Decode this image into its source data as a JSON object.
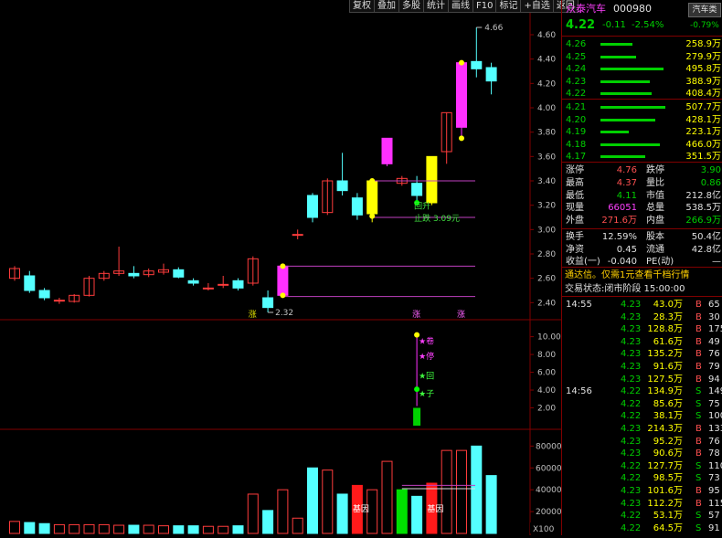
{
  "toolbar": [
    "复权",
    "叠加",
    "多股",
    "统计",
    "画线",
    "F10",
    "标记",
    "+自选",
    "返回"
  ],
  "header": {
    "name": "众泰汽车",
    "code": "000980",
    "sector_btn": "汽车类",
    "price": "4.22",
    "change": "-0.11",
    "pct": "-2.54%",
    "sector_pct": "-0.79%"
  },
  "asks": [
    {
      "price": "4.26",
      "vol": "258.9万",
      "bar": 0.42
    },
    {
      "price": "4.25",
      "vol": "279.9万",
      "bar": 0.46
    },
    {
      "price": "4.24",
      "vol": "495.8万",
      "bar": 0.82
    },
    {
      "price": "4.23",
      "vol": "388.9万",
      "bar": 0.64
    },
    {
      "price": "4.22",
      "vol": "408.4万",
      "bar": 0.67
    }
  ],
  "bids": [
    {
      "price": "4.21",
      "vol": "507.7万",
      "bar": 0.84
    },
    {
      "price": "4.20",
      "vol": "428.1万",
      "bar": 0.71
    },
    {
      "price": "4.19",
      "vol": "223.1万",
      "bar": 0.37
    },
    {
      "price": "4.18",
      "vol": "466.0万",
      "bar": 0.77
    },
    {
      "price": "4.17",
      "vol": "351.5万",
      "bar": 0.58
    }
  ],
  "stats": [
    {
      "l1": "涨停",
      "v1": "4.76",
      "c1": "up",
      "l2": "跌停",
      "v2": "3.90",
      "c2": "down"
    },
    {
      "l1": "最高",
      "v1": "4.37",
      "c1": "up",
      "l2": "量比",
      "v2": "0.86",
      "c2": "down"
    },
    {
      "l1": "最低",
      "v1": "4.11",
      "c1": "down",
      "l2": "市值",
      "v2": "212.8亿",
      "c2": "white"
    },
    {
      "l1": "现量",
      "v1": "66051",
      "c1": "magenta",
      "l2": "总量",
      "v2": "538.5万",
      "c2": "white"
    },
    {
      "l1": "外盘",
      "v1": "271.6万",
      "c1": "up",
      "l2": "内盘",
      "v2": "266.9万",
      "c2": "down"
    }
  ],
  "stats2": [
    {
      "l1": "换手",
      "v1": "12.59%",
      "l2": "股本",
      "v2": "50.4亿"
    },
    {
      "l1": "净资",
      "v1": "0.45",
      "l2": "流通",
      "v2": "42.8亿"
    },
    {
      "l1": "收益(一)",
      "v1": "-0.040",
      "l2": "PE(动)",
      "v2": "—"
    }
  ],
  "promo": "通达信。仅需1元查看千档行情",
  "trade_status": "交易状态:闭市阶段 15:00:00",
  "ticks": [
    {
      "time": "14:55",
      "price": "4.23",
      "vol": "43.0万",
      "bs": "B",
      "n": "65"
    },
    {
      "time": "",
      "price": "4.23",
      "vol": "28.3万",
      "bs": "B",
      "n": "30"
    },
    {
      "time": "",
      "price": "4.23",
      "vol": "128.8万",
      "bs": "B",
      "n": "175"
    },
    {
      "time": "",
      "price": "4.23",
      "vol": "61.6万",
      "bs": "B",
      "n": "49"
    },
    {
      "time": "",
      "price": "4.23",
      "vol": "135.2万",
      "bs": "B",
      "n": "76"
    },
    {
      "time": "",
      "price": "4.23",
      "vol": "91.6万",
      "bs": "B",
      "n": "79"
    },
    {
      "time": "",
      "price": "4.23",
      "vol": "127.5万",
      "bs": "B",
      "n": "94"
    },
    {
      "time": "14:56",
      "price": "4.22",
      "vol": "134.9万",
      "bs": "S",
      "n": "149"
    },
    {
      "time": "",
      "price": "4.22",
      "vol": "85.6万",
      "bs": "S",
      "n": "75"
    },
    {
      "time": "",
      "price": "4.22",
      "vol": "38.1万",
      "bs": "S",
      "n": "100"
    },
    {
      "time": "",
      "price": "4.23",
      "vol": "214.3万",
      "bs": "B",
      "n": "133"
    },
    {
      "time": "",
      "price": "4.23",
      "vol": "95.2万",
      "bs": "B",
      "n": "76"
    },
    {
      "time": "",
      "price": "4.23",
      "vol": "90.6万",
      "bs": "B",
      "n": "78"
    },
    {
      "time": "",
      "price": "4.22",
      "vol": "127.7万",
      "bs": "S",
      "n": "110"
    },
    {
      "time": "",
      "price": "4.22",
      "vol": "98.5万",
      "bs": "S",
      "n": "73"
    },
    {
      "time": "",
      "price": "4.23",
      "vol": "101.6万",
      "bs": "B",
      "n": "95"
    },
    {
      "time": "",
      "price": "4.23",
      "vol": "112.2万",
      "bs": "B",
      "n": "115"
    },
    {
      "time": "",
      "price": "4.22",
      "vol": "53.1万",
      "bs": "S",
      "n": "57"
    },
    {
      "time": "",
      "price": "4.22",
      "vol": "64.5万",
      "bs": "S",
      "n": "91"
    }
  ],
  "chart_data": {
    "type": "candlestick",
    "price_axis": {
      "ticks": [
        "4.60",
        "4.40",
        "4.20",
        "4.00",
        "3.80",
        "3.60",
        "3.40",
        "3.20",
        "3.00",
        "2.80",
        "2.60",
        "2.40"
      ],
      "range": [
        2.26,
        4.78
      ]
    },
    "candles": [
      {
        "o": 2.6,
        "c": 2.68,
        "h": 2.7,
        "l": 2.58
      },
      {
        "o": 2.62,
        "c": 2.5,
        "h": 2.66,
        "l": 2.48
      },
      {
        "o": 2.5,
        "c": 2.44,
        "h": 2.52,
        "l": 2.42
      },
      {
        "o": 2.42,
        "c": 2.42,
        "h": 2.44,
        "l": 2.39
      },
      {
        "o": 2.41,
        "c": 2.46,
        "h": 2.47,
        "l": 2.4
      },
      {
        "o": 2.46,
        "c": 2.6,
        "h": 2.62,
        "l": 2.45
      },
      {
        "o": 2.6,
        "c": 2.64,
        "h": 2.66,
        "l": 2.58
      },
      {
        "o": 2.64,
        "c": 2.66,
        "h": 2.86,
        "l": 2.62
      },
      {
        "o": 2.64,
        "c": 2.62,
        "h": 2.7,
        "l": 2.6
      },
      {
        "o": 2.63,
        "c": 2.66,
        "h": 2.68,
        "l": 2.61
      },
      {
        "o": 2.65,
        "c": 2.67,
        "h": 2.72,
        "l": 2.63
      },
      {
        "o": 2.67,
        "c": 2.61,
        "h": 2.69,
        "l": 2.6
      },
      {
        "o": 2.58,
        "c": 2.56,
        "h": 2.6,
        "l": 2.54
      },
      {
        "o": 2.52,
        "c": 2.52,
        "h": 2.56,
        "l": 2.5
      },
      {
        "o": 2.55,
        "c": 2.55,
        "h": 2.62,
        "l": 2.52
      },
      {
        "o": 2.58,
        "c": 2.52,
        "h": 2.6,
        "l": 2.5
      },
      {
        "o": 2.56,
        "c": 2.76,
        "h": 2.78,
        "l": 2.54
      },
      {
        "o": 2.44,
        "c": 2.36,
        "h": 2.5,
        "l": 2.32
      },
      {
        "o": 2.46,
        "c": 2.7,
        "h": 2.7,
        "l": 2.44
      },
      {
        "o": 2.96,
        "c": 2.96,
        "h": 3.0,
        "l": 2.92
      },
      {
        "o": 3.28,
        "c": 3.1,
        "h": 3.3,
        "l": 3.06
      },
      {
        "o": 3.14,
        "c": 3.4,
        "h": 3.42,
        "l": 3.12
      },
      {
        "o": 3.4,
        "c": 3.32,
        "h": 3.63,
        "l": 3.28
      },
      {
        "o": 3.26,
        "c": 3.12,
        "h": 3.3,
        "l": 3.08
      },
      {
        "o": 3.13,
        "c": 3.4,
        "h": 3.4,
        "l": 3.06
      },
      {
        "o": 3.54,
        "c": 3.75,
        "h": 3.75,
        "l": 3.52
      },
      {
        "o": 3.38,
        "c": 3.42,
        "h": 3.44,
        "l": 3.36
      },
      {
        "o": 3.38,
        "c": 3.28,
        "h": 3.44,
        "l": 3.2
      },
      {
        "o": 3.22,
        "c": 3.6,
        "h": 3.6,
        "l": 3.2
      },
      {
        "o": 3.64,
        "c": 3.96,
        "h": 3.96,
        "l": 3.54
      },
      {
        "o": 3.84,
        "c": 4.37,
        "h": 4.38,
        "l": 3.73
      },
      {
        "o": 4.38,
        "c": 4.32,
        "h": 4.66,
        "l": 4.25
      },
      {
        "o": 4.33,
        "c": 4.22,
        "h": 4.37,
        "l": 4.11
      }
    ],
    "annotations": {
      "high_label": "4.66",
      "low_label": "2.32",
      "sig1": "涨",
      "sig2": "涨",
      "sig3": "涨",
      "cyan_text1": "回升",
      "cyan_text2": "止跌 3.09元"
    },
    "mid_axis": {
      "ticks": [
        "10.00",
        "8.00",
        "6.00",
        "4.00",
        "2.00"
      ],
      "range": [
        0,
        11.5
      ]
    },
    "mid_labels": [
      "★卷",
      "★停",
      "★回",
      "★子"
    ],
    "vol_axis": {
      "ticks": [
        "80000",
        "60000",
        "40000",
        "20000"
      ],
      "range": [
        0,
        92000
      ],
      "unit": "X100"
    },
    "volumes": [
      11000,
      10000,
      9000,
      8000,
      8000,
      8000,
      8000,
      7500,
      7500,
      7500,
      7000,
      7000,
      7000,
      6500,
      6500,
      7000,
      36000,
      21000,
      40000,
      14000,
      60000,
      58000,
      36000,
      44000,
      40000,
      66000,
      40000,
      34000,
      46000,
      76000,
      76000,
      80000,
      53000
    ],
    "vol_labels": [
      "基因",
      "基因"
    ]
  }
}
